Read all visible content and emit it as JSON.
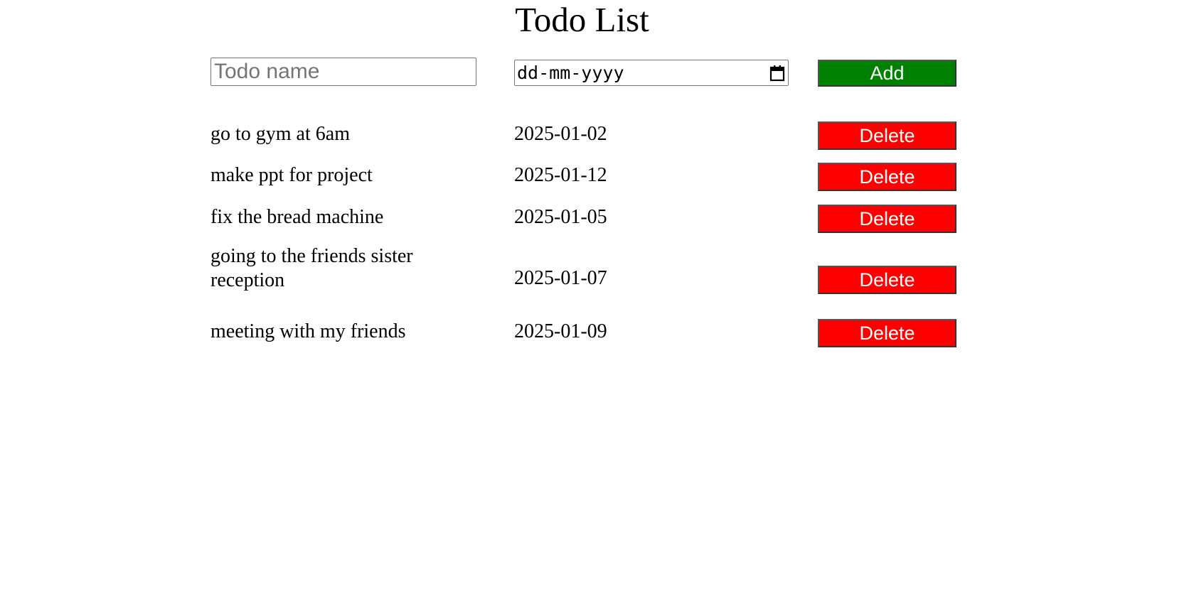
{
  "page": {
    "title": "Todo List"
  },
  "form": {
    "name_placeholder": "Todo name",
    "name_value": "",
    "date_placeholder": "dd-mm-yyyy",
    "add_label": "Add",
    "add_color": "#008000"
  },
  "todos": [
    {
      "name": "go to gym at 6am",
      "date": "2025-01-02",
      "delete_label": "Delete"
    },
    {
      "name": "make ppt for project",
      "date": "2025-01-12",
      "delete_label": "Delete"
    },
    {
      "name": "fix the bread machine",
      "date": "2025-01-05",
      "delete_label": "Delete"
    },
    {
      "name": "going to the friends sister reception",
      "date": "2025-01-07",
      "delete_label": "Delete"
    },
    {
      "name": "meeting with my friends",
      "date": "2025-01-09",
      "delete_label": "Delete"
    }
  ],
  "colors": {
    "delete": "#ff0000",
    "button_text": "#ffffff"
  },
  "icons": {
    "date_picker": "calendar-icon"
  }
}
